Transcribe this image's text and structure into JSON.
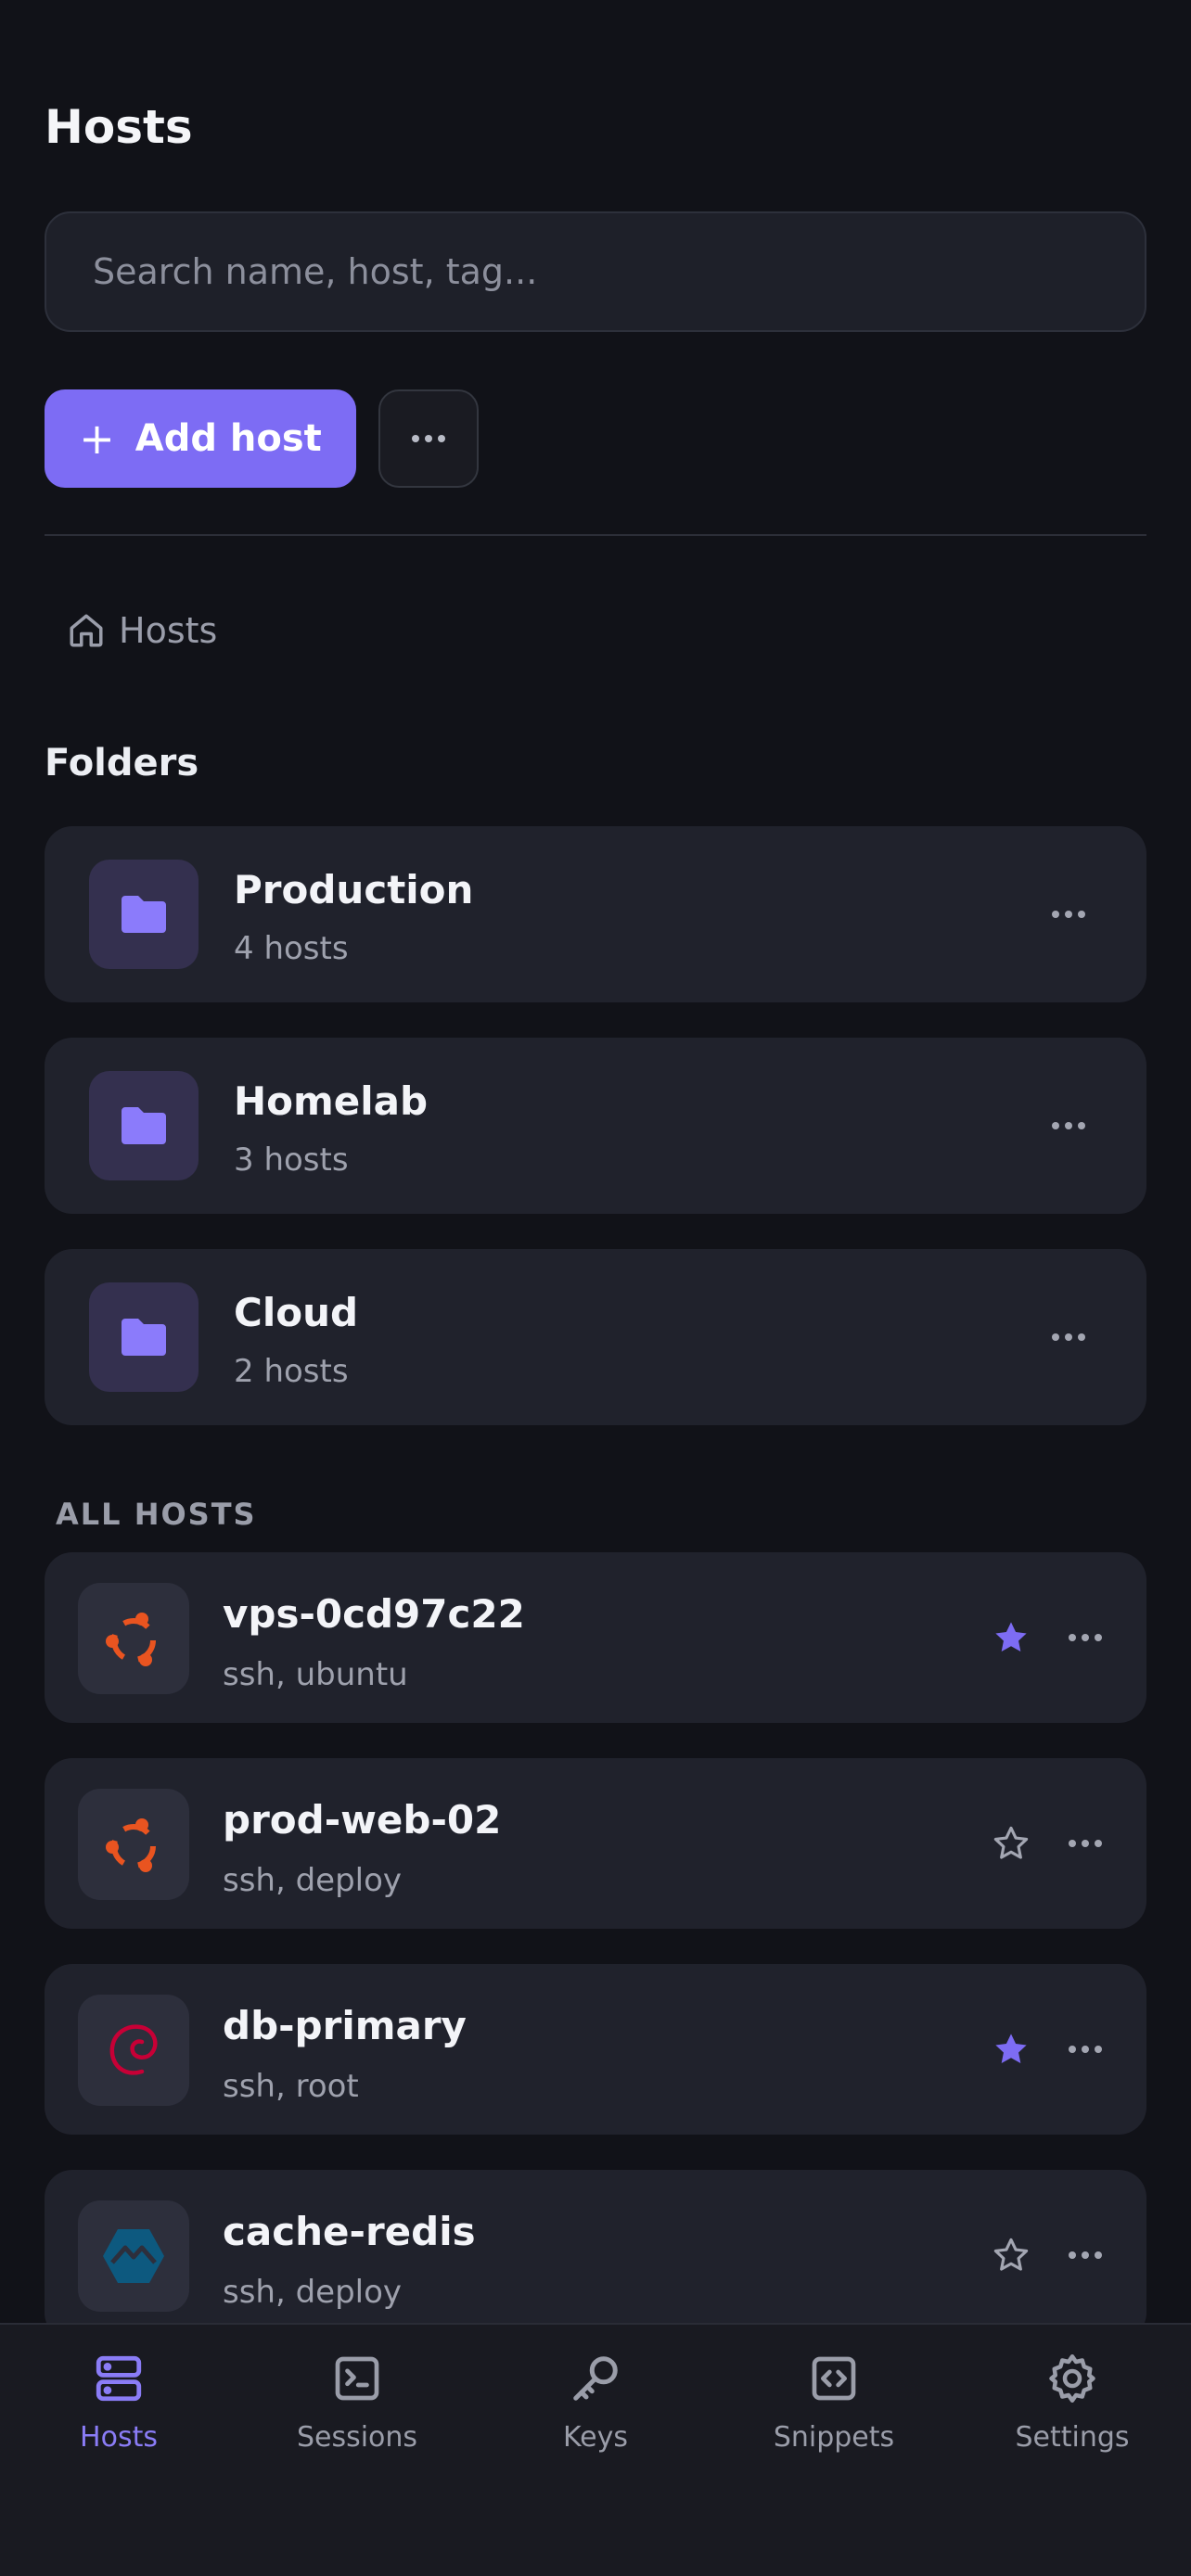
{
  "header": {
    "title": "Hosts"
  },
  "search": {
    "placeholder": "Search name, host, tag..."
  },
  "toolbar": {
    "add_label": "Add host",
    "add_icon": "plus-icon",
    "more_icon": "ellipsis-icon"
  },
  "breadcrumb": {
    "label": "Hosts",
    "icon": "home-icon"
  },
  "folders": {
    "title": "Folders",
    "items": [
      {
        "name": "Production",
        "count": "4 hosts"
      },
      {
        "name": "Homelab",
        "count": "3 hosts"
      },
      {
        "name": "Cloud",
        "count": "2 hosts"
      }
    ]
  },
  "hosts": {
    "title": "ALL HOSTS",
    "items": [
      {
        "name": "vps-0cd97c22",
        "meta": "ssh, ubuntu",
        "os": "ubuntu",
        "favorite": true
      },
      {
        "name": "prod-web-02",
        "meta": "ssh, deploy",
        "os": "ubuntu",
        "favorite": false
      },
      {
        "name": "db-primary",
        "meta": "ssh, root",
        "os": "debian",
        "favorite": true
      },
      {
        "name": "cache-redis",
        "meta": "ssh, deploy",
        "os": "alpine",
        "favorite": false
      }
    ]
  },
  "tabs": [
    {
      "label": "Hosts",
      "icon": "server-icon",
      "active": true
    },
    {
      "label": "Sessions",
      "icon": "terminal-icon",
      "active": false
    },
    {
      "label": "Keys",
      "icon": "key-icon",
      "active": false
    },
    {
      "label": "Snippets",
      "icon": "code-icon",
      "active": false
    },
    {
      "label": "Settings",
      "icon": "gear-icon",
      "active": false
    }
  ],
  "colors": {
    "accent": "#7d6cf4",
    "background": "#111218",
    "card": "#20222c",
    "ubuntu": "#e95420",
    "debian": "#c70036",
    "alpine": "#0d597f"
  }
}
